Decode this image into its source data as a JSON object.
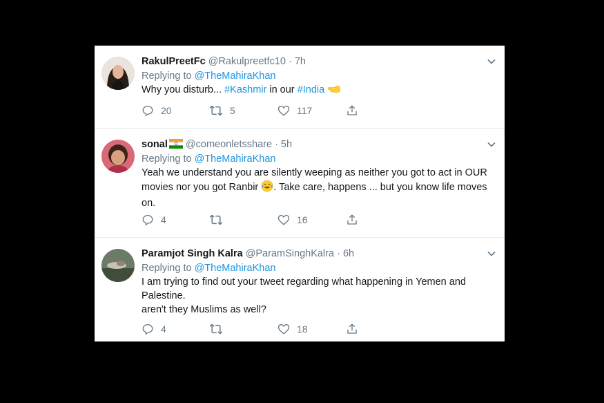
{
  "tweets": [
    {
      "name": "RakulPreetFc",
      "handle": "@Rakulpreetfc10",
      "time": "· 7h",
      "replying_label": "Replying to",
      "replying_to": "@TheMahiraKhan",
      "text_before": "Why you disturb... ",
      "hashtag1": "#Kashmir",
      "text_middle": " in our ",
      "hashtag2": "#India",
      "emoji": "pointing-left-hand",
      "replies": "20",
      "retweets": "5",
      "likes": "117"
    },
    {
      "name": "sonal",
      "name_flag": "india-flag",
      "handle": "@comeonletsshare",
      "time": "· 5h",
      "replying_label": "Replying to",
      "replying_to": "@TheMahiraKhan",
      "text_line1": "Yeah we understand you are silently weeping as neither you got to act in OUR",
      "text_line2a": "movies nor you got Ranbir ",
      "text_line2b": ". Take care, happens ... but you know life moves",
      "text_line3": "on.",
      "emoji": "tears-of-joy-face",
      "replies": "4",
      "retweets": "",
      "likes": "16"
    },
    {
      "name": "Paramjot Singh Kalra",
      "handle": "@ParamSinghKalra",
      "time": "· 6h",
      "replying_label": "Replying to",
      "replying_to": "@TheMahiraKhan",
      "text_line1": "I am trying to find out your tweet regarding what happening in Yemen and",
      "text_line2": "Palestine.",
      "text_line3": "aren't they Muslims as well?",
      "replies": "4",
      "retweets": "",
      "likes": "18"
    }
  ],
  "colors": {
    "link": "#1b95e0",
    "muted": "#657786",
    "text": "#14171a",
    "background": "#000000",
    "card": "#ffffff"
  }
}
